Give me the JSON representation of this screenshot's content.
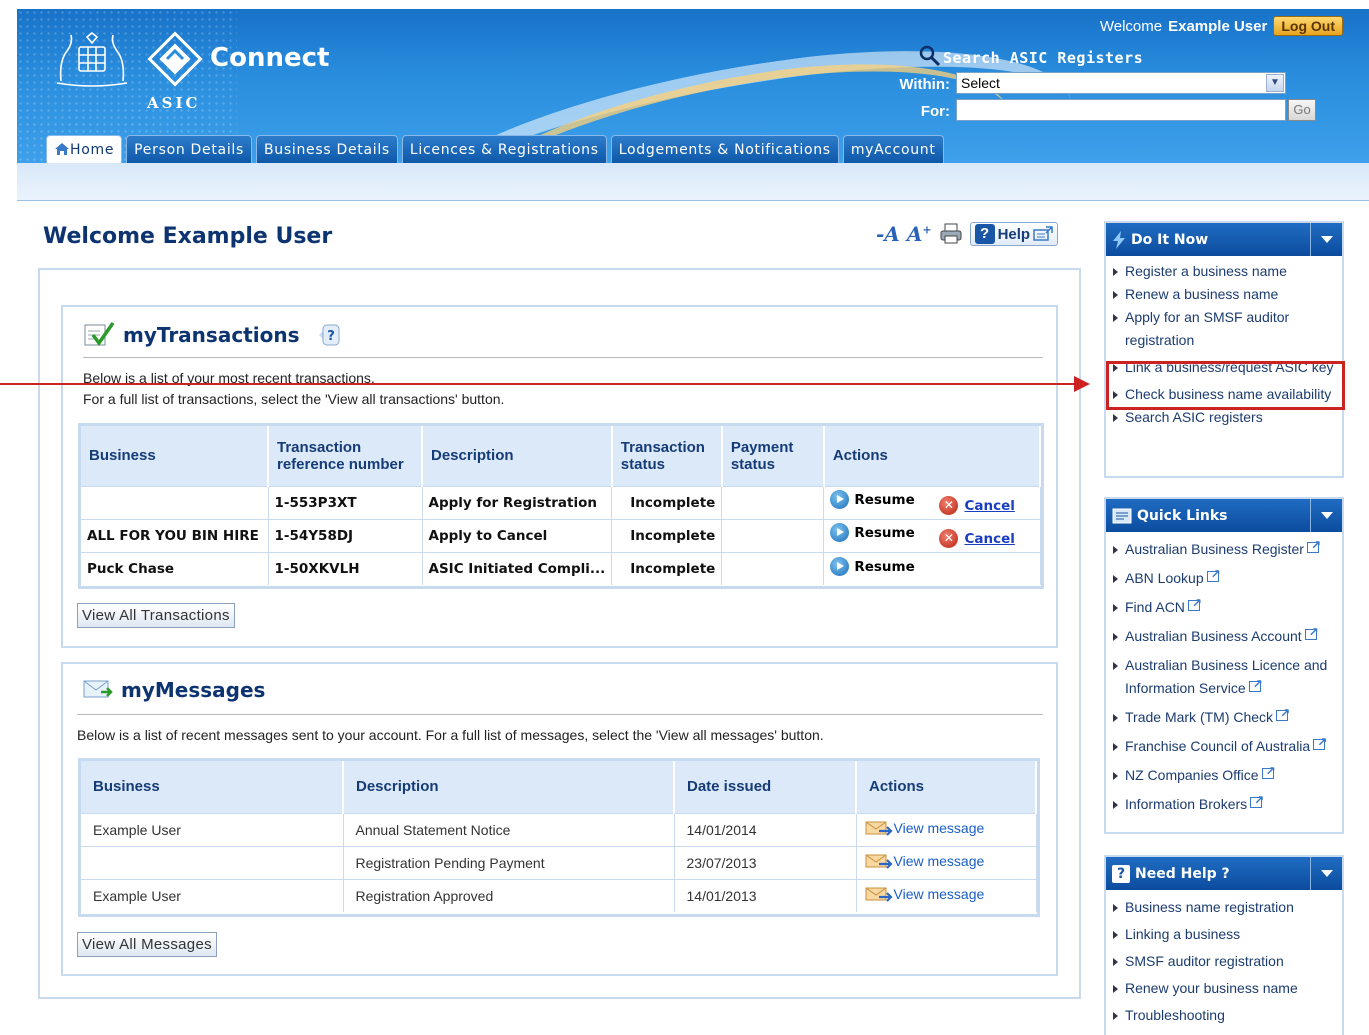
{
  "header": {
    "brand": "Connect",
    "brand_sub": "ASIC",
    "welcome": "Welcome",
    "user": "Example User",
    "logout": "Log Out",
    "search_title": "Search ASIC Registers",
    "within_label": "Within:",
    "within_value": "Select",
    "for_label": "For:",
    "for_value": "",
    "go": "Go"
  },
  "tabs": [
    {
      "label": "Home",
      "active": true
    },
    {
      "label": "Person Details"
    },
    {
      "label": "Business Details"
    },
    {
      "label": "Licences & Registrations"
    },
    {
      "label": "Lodgements & Notifications"
    },
    {
      "label": "myAccount"
    }
  ],
  "main": {
    "title": "Welcome Example User",
    "help": "Help"
  },
  "transactions": {
    "title": "myTransactions",
    "intro1": "Below is a list of your most recent transactions.",
    "intro2": "For a full list of transactions, select the 'View all transactions' button.",
    "headers": [
      "Business",
      "Transaction reference number",
      "Description",
      "Transaction status",
      "Payment status",
      "Actions"
    ],
    "rows": [
      {
        "business": "",
        "ref": "1-553P3XT",
        "desc": "Apply for Registration",
        "status": "Incomplete",
        "payment": "",
        "resume": "Resume",
        "cancel": "Cancel"
      },
      {
        "business": "ALL FOR YOU BIN HIRE",
        "ref": "1-54Y58DJ",
        "desc": "Apply to Cancel",
        "status": "Incomplete",
        "payment": "",
        "resume": "Resume",
        "cancel": "Cancel"
      },
      {
        "business": "Puck Chase",
        "ref": "1-50XKVLH",
        "desc": "ASIC Initiated Compli...",
        "status": "Incomplete",
        "payment": "",
        "resume": "Resume",
        "cancel": ""
      }
    ],
    "button": "View All Transactions"
  },
  "messages": {
    "title": "myMessages",
    "intro": "Below is a list of recent messages sent to your account. For a full list of messages, select the 'View all messages' button.",
    "headers": [
      "Business",
      "Description",
      "Date issued",
      "Actions"
    ],
    "rows": [
      {
        "business": "Example User",
        "desc": "Annual Statement Notice",
        "date": "14/01/2014",
        "action": "View message"
      },
      {
        "business": "",
        "desc": "Registration Pending Payment",
        "date": "23/07/2013",
        "action": "View message"
      },
      {
        "business": "Example User",
        "desc": "Registration Approved",
        "date": "14/01/2013",
        "action": "View message"
      }
    ],
    "button": "View All Messages"
  },
  "sidebar": {
    "do_it_now": {
      "title": "Do It Now",
      "items": [
        "Register a business name",
        "Renew a business name",
        "Apply for an SMSF auditor registration",
        "Link a business/request ASIC key",
        "Check business name availability",
        "Search ASIC registers"
      ]
    },
    "quick_links": {
      "title": "Quick Links",
      "items": [
        "Australian Business Register",
        "ABN Lookup",
        "Find ACN",
        "Australian Business Account",
        "Australian Business Licence and Information Service",
        "Trade Mark (TM) Check",
        "Franchise Council of Australia",
        "NZ Companies Office",
        "Information Brokers"
      ]
    },
    "need_help": {
      "title": "Need Help ?",
      "items": [
        "Business name registration",
        "Linking a business",
        "SMSF auditor registration",
        "Renew your business name",
        "Troubleshooting"
      ]
    }
  },
  "colors": {
    "header_blue": "#1872c8",
    "title_navy": "#0d3470",
    "highlight_red": "#cc2222",
    "link_blue": "#1a3ec0"
  }
}
